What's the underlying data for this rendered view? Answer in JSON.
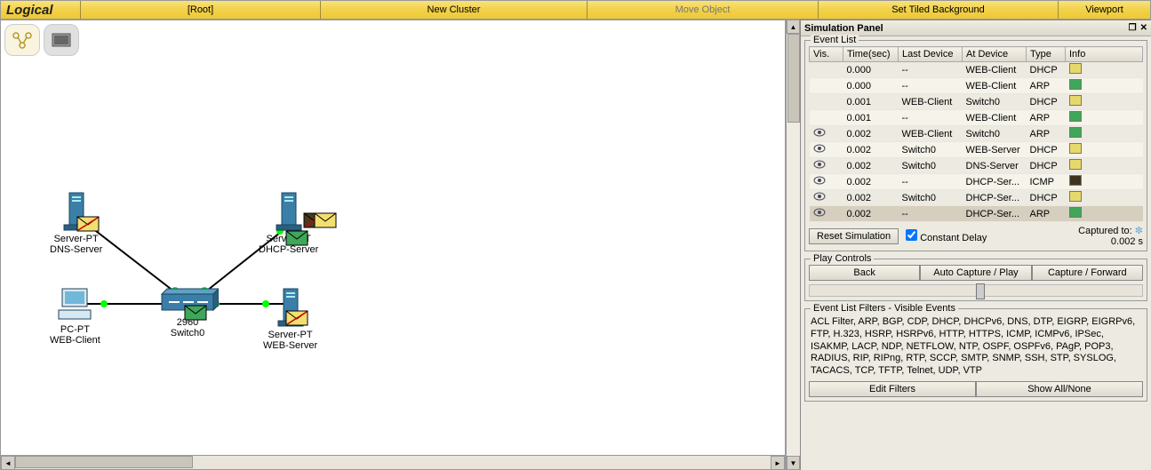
{
  "toolbar": {
    "logical": "Logical",
    "root": "[Root]",
    "new_cluster": "New Cluster",
    "move_object": "Move Object",
    "set_bg": "Set Tiled Background",
    "viewport": "Viewport"
  },
  "sim_panel_title": "Simulation Panel",
  "event_list": {
    "title": "Event List",
    "columns": {
      "vis": "Vis.",
      "time": "Time(sec)",
      "last": "Last Device",
      "at": "At Device",
      "type": "Type",
      "info": "Info"
    },
    "rows": [
      {
        "eye": false,
        "time": "0.000",
        "last": "--",
        "at": "WEB-Client",
        "type": "DHCP",
        "color": "#e6d96a"
      },
      {
        "eye": false,
        "time": "0.000",
        "last": "--",
        "at": "WEB-Client",
        "type": "ARP",
        "color": "#3fa65a"
      },
      {
        "eye": false,
        "time": "0.001",
        "last": "WEB-Client",
        "at": "Switch0",
        "type": "DHCP",
        "color": "#e6d96a"
      },
      {
        "eye": false,
        "time": "0.001",
        "last": "--",
        "at": "WEB-Client",
        "type": "ARP",
        "color": "#3fa65a"
      },
      {
        "eye": true,
        "time": "0.002",
        "last": "WEB-Client",
        "at": "Switch0",
        "type": "ARP",
        "color": "#3fa65a"
      },
      {
        "eye": true,
        "time": "0.002",
        "last": "Switch0",
        "at": "WEB-Server",
        "type": "DHCP",
        "color": "#e6d96a"
      },
      {
        "eye": true,
        "time": "0.002",
        "last": "Switch0",
        "at": "DNS-Server",
        "type": "DHCP",
        "color": "#e6d96a"
      },
      {
        "eye": true,
        "time": "0.002",
        "last": "--",
        "at": "DHCP-Ser...",
        "type": "ICMP",
        "color": "#3d341b"
      },
      {
        "eye": true,
        "time": "0.002",
        "last": "Switch0",
        "at": "DHCP-Ser...",
        "type": "DHCP",
        "color": "#e6d96a"
      },
      {
        "eye": true,
        "time": "0.002",
        "last": "--",
        "at": "DHCP-Ser...",
        "type": "ARP",
        "color": "#3fa65a",
        "sel": true
      }
    ]
  },
  "reset_btn": "Reset Simulation",
  "constant_delay": "Constant Delay",
  "captured_label": "Captured to:",
  "captured_value": "0.002 s",
  "play_controls": {
    "title": "Play Controls",
    "back": "Back",
    "auto": "Auto Capture / Play",
    "fwd": "Capture / Forward"
  },
  "filters": {
    "title": "Event List Filters - Visible Events",
    "text": "ACL Filter, ARP, BGP, CDP, DHCP, DHCPv6, DNS, DTP, EIGRP, EIGRPv6, FTP, H.323, HSRP, HSRPv6, HTTP, HTTPS, ICMP, ICMPv6, IPSec, ISAKMP, LACP, NDP, NETFLOW, NTP, OSPF, OSPFv6, PAgP, POP3, RADIUS, RIP, RIPng, RTP, SCCP, SMTP, SNMP, SSH, STP, SYSLOG, TACACS, TCP, TFTP, Telnet, UDP, VTP",
    "edit": "Edit Filters",
    "show_all": "Show All/None"
  },
  "nodes": {
    "dns": {
      "line1": "Server-PT",
      "line2": "DNS-Server"
    },
    "dhcp": {
      "line1": "Server-PT",
      "line2": "DHCP-Server"
    },
    "web": {
      "line1": "Server-PT",
      "line2": "WEB-Server"
    },
    "pc": {
      "line1": "PC-PT",
      "line2": "WEB-Client"
    },
    "sw": {
      "line1": "2960",
      "line2": "Switch0"
    }
  }
}
